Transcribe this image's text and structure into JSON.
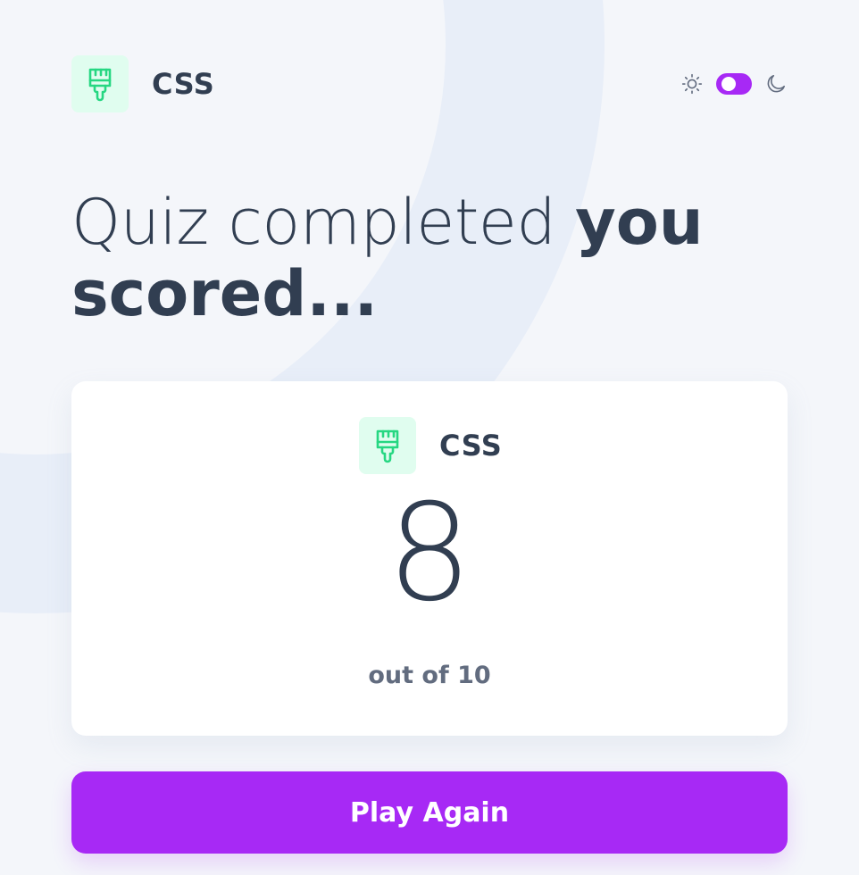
{
  "header": {
    "subject_title": "CSS",
    "subject_icon": "paintbrush-icon",
    "theme": {
      "light_icon": "sun-icon",
      "dark_icon": "moon-icon",
      "toggle_state": "light"
    }
  },
  "heading": {
    "light_text": "Quiz completed ",
    "bold_text": "you scored..."
  },
  "score_card": {
    "subject_title": "CSS",
    "subject_icon": "paintbrush-icon",
    "score": "8",
    "total": "out of 10"
  },
  "actions": {
    "play_again_label": "Play Again"
  },
  "colors": {
    "accent": "#a729f5",
    "icon_bg": "#e0fdef",
    "icon_stroke": "#26d782",
    "text_dark": "#313e51",
    "text_muted": "#626c7f",
    "background": "#f4f6fa"
  }
}
